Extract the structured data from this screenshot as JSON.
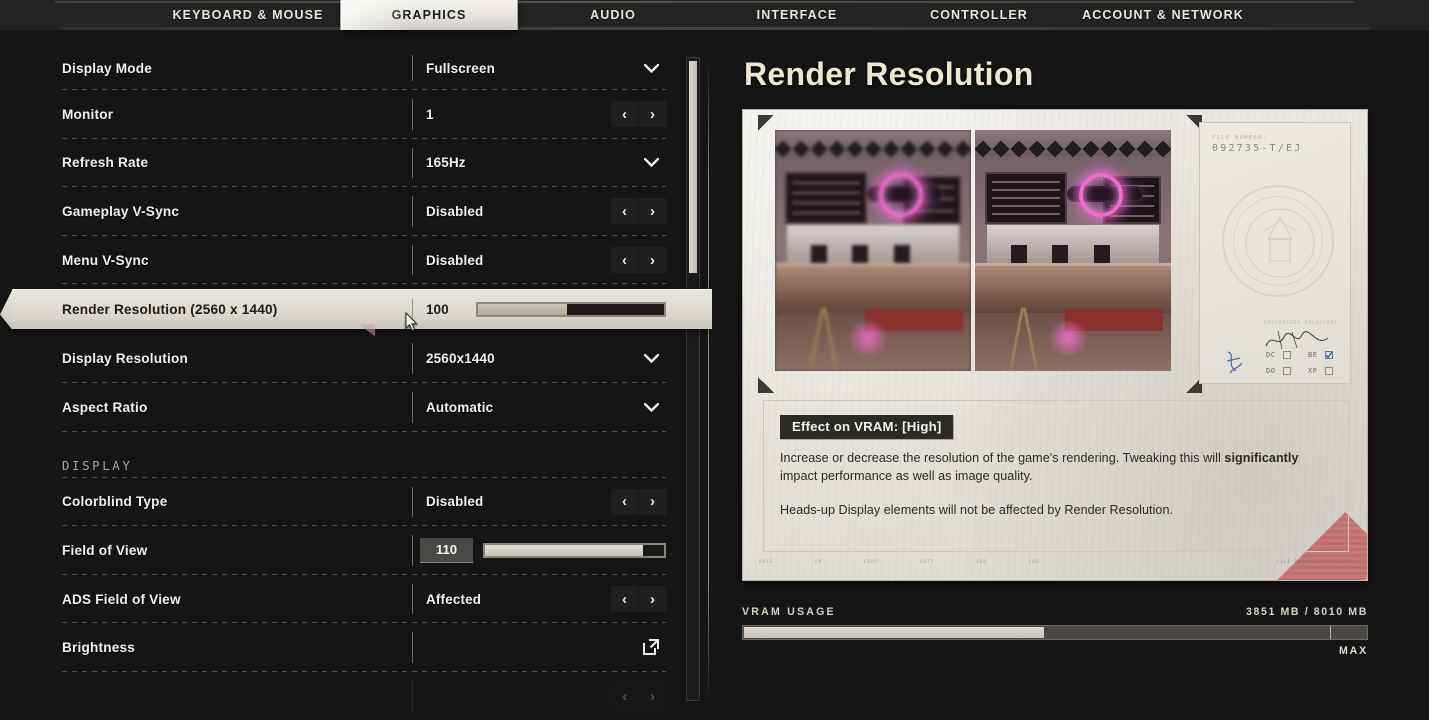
{
  "nav": {
    "tabs": [
      {
        "label": "KEYBOARD & MOUSE",
        "active": false
      },
      {
        "label": "GRAPHICS",
        "active": true
      },
      {
        "label": "AUDIO",
        "active": false
      },
      {
        "label": "INTERFACE",
        "active": false
      },
      {
        "label": "CONTROLLER",
        "active": false
      },
      {
        "label": "ACCOUNT & NETWORK",
        "active": false
      }
    ]
  },
  "settings": {
    "rows": [
      {
        "label": "Display Mode",
        "value": "Fullscreen",
        "control": "dropdown"
      },
      {
        "label": "Monitor",
        "value": "1",
        "control": "stepper"
      },
      {
        "label": "Refresh Rate",
        "value": "165Hz",
        "control": "dropdown"
      },
      {
        "label": "Gameplay V-Sync",
        "value": "Disabled",
        "control": "stepper"
      },
      {
        "label": "Menu V-Sync",
        "value": "Disabled",
        "control": "stepper"
      },
      {
        "label": "Render Resolution (2560 x 1440)",
        "value": "100",
        "control": "slider",
        "fill_percent": 48,
        "selected": true
      },
      {
        "label": "Display Resolution",
        "value": "2560x1440",
        "control": "dropdown"
      },
      {
        "label": "Aspect Ratio",
        "value": "Automatic",
        "control": "dropdown"
      }
    ],
    "section_label": "DISPLAY",
    "display_rows": [
      {
        "label": "Colorblind Type",
        "value": "Disabled",
        "control": "stepper"
      },
      {
        "label": "Field of View",
        "value": "110",
        "control": "slider",
        "fill_percent": 88
      },
      {
        "label": "ADS Field of View",
        "value": "Affected",
        "control": "stepper"
      },
      {
        "label": "Brightness",
        "value": "",
        "control": "external-link"
      }
    ],
    "stepper_left_icon": "chevron-left-icon",
    "stepper_right_icon": "chevron-right-icon",
    "dropdown_icon": "chevron-down-icon",
    "external_icon": "external-link-icon"
  },
  "preview": {
    "title": "Render Resolution",
    "file_label": "FILE NUMBER:",
    "file_number": "092735-T/EJ",
    "signature_label": "AUTHORIZED SIGNATURE",
    "checkboxes": [
      {
        "label": "DC",
        "checked": false
      },
      {
        "label": "BE",
        "checked": true
      },
      {
        "label": "DO",
        "checked": false
      },
      {
        "label": "XP",
        "checked": false
      }
    ],
    "vram_badge": "Effect on VRAM: [High]",
    "description_1_a": "Increase or decrease the resolution of the game's rendering. Tweaking this will ",
    "description_1_bold": "significantly",
    "description_1_b": " impact performance as well as image quality.",
    "description_2": "Heads-up Display elements will not be affected by Render Resolution.",
    "footer_micro": [
      "DATE",
      "OP",
      "CERT",
      "BATT",
      "SUB",
      "LOG"
    ],
    "footer_micro_right": "FILE SECTION RESERVED"
  },
  "vram": {
    "label": "VRAM USAGE",
    "value": "3851 MB / 8010 MB",
    "used_mb": 3851,
    "total_mb": 8010,
    "fill_percent": 48,
    "tick_percent": 94,
    "max_label": "MAX"
  },
  "scrollbar": {
    "thumb_top_percent": 0,
    "thumb_height_percent": 33
  },
  "colors": {
    "background": "#151515",
    "nav_bar": "#232322",
    "accent_title": "#efe6cf",
    "paper": "#e9e5dd",
    "selected_row": "#ddd9d0",
    "text_light": "#f2f0eb",
    "red_band": "#c36a6a"
  }
}
